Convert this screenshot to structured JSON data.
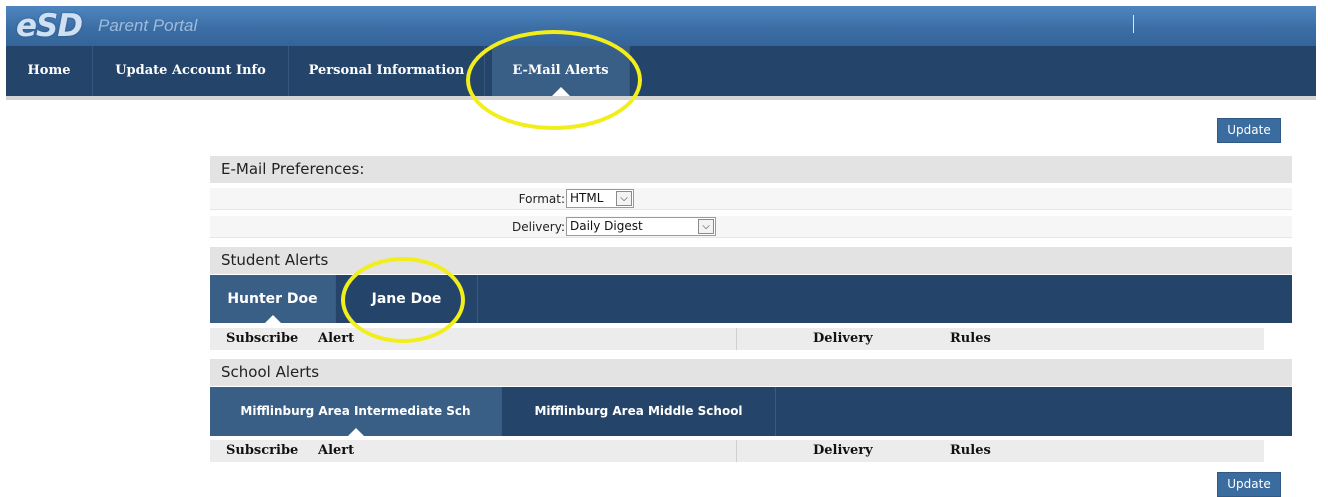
{
  "banner": {
    "logo_mark": "eSD",
    "logo_text": "Parent Portal"
  },
  "main_nav": {
    "tabs": [
      {
        "label": "Home"
      },
      {
        "label": "Update Account Info"
      },
      {
        "label": "Personal Information"
      },
      {
        "label": "E-Mail Alerts",
        "active": true
      }
    ]
  },
  "actions": {
    "update_label": "Update"
  },
  "email_preferences": {
    "title": "E-Mail Preferences:",
    "format_label": "Format:",
    "format_value": "HTML",
    "delivery_label": "Delivery:",
    "delivery_value": "Daily Digest"
  },
  "student_alerts": {
    "title": "Student Alerts",
    "tabs": [
      {
        "label": "Hunter Doe",
        "active": true
      },
      {
        "label": "Jane Doe"
      }
    ],
    "columns": [
      "Subscribe",
      "Alert",
      "Delivery",
      "Rules"
    ]
  },
  "school_alerts": {
    "title": "School Alerts",
    "tabs": [
      {
        "label": "Mifflinburg Area Intermediate Sch",
        "active": true
      },
      {
        "label": "Mifflinburg Area Middle School"
      }
    ],
    "columns": [
      "Subscribe",
      "Alert",
      "Delivery",
      "Rules"
    ]
  },
  "colors": {
    "nav_bg": "#24446a",
    "nav_active": "#3a5f87",
    "button": "#3a6c9f",
    "highlight": "#f2ee1c"
  },
  "icons": {
    "select_arrow": "chevron-down-icon"
  }
}
